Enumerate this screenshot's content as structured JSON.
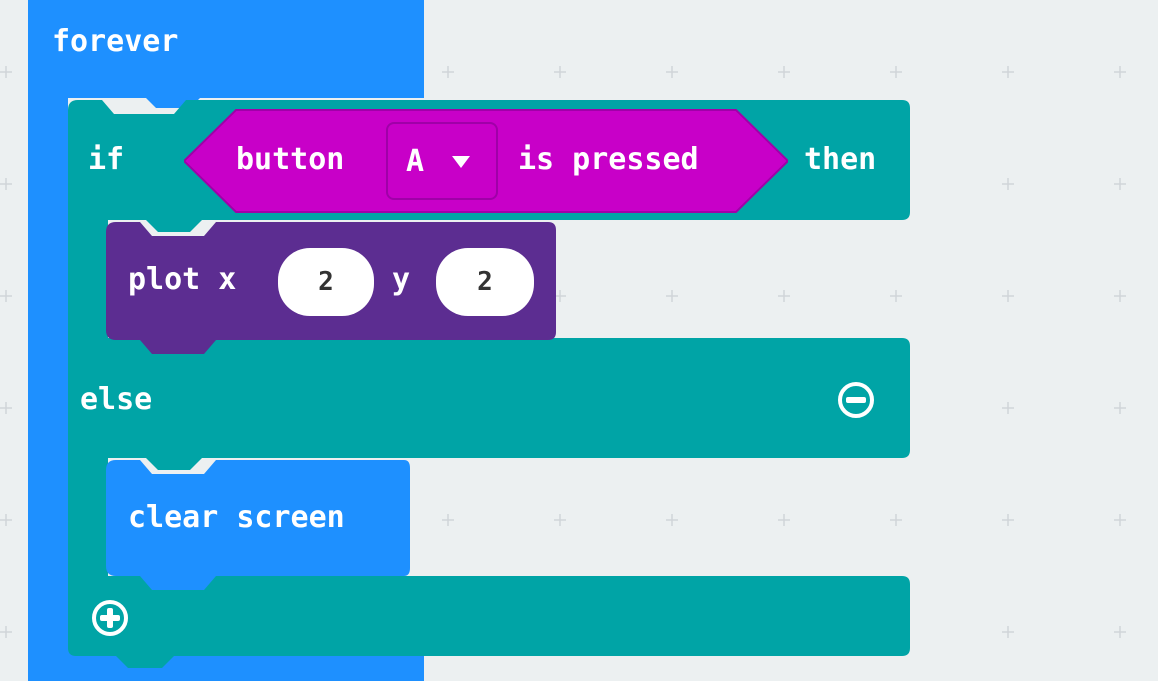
{
  "workspace": {
    "background": "#ecf0f1"
  },
  "colors": {
    "loops_blue": "#1e90ff",
    "logic_teal": "#00a4a6",
    "input_magenta": "#c800c8",
    "led_purple": "#5c2d91",
    "basic_blue": "#1e90ff"
  },
  "forever_block": {
    "label": "forever"
  },
  "if_block": {
    "if_label": "if",
    "then_label": "then",
    "else_label": "else",
    "remove_else_icon": "minus-circle-icon",
    "add_branch_icon": "plus-circle-icon"
  },
  "button_pressed_block": {
    "button_label": "button",
    "dropdown_value": "A",
    "dropdown_icon": "triangle-down-icon",
    "suffix_label": "is pressed"
  },
  "plot_block": {
    "label": "plot x",
    "x_value": "2",
    "y_label": "y",
    "y_value": "2"
  },
  "clear_screen_block": {
    "label": "clear screen"
  }
}
